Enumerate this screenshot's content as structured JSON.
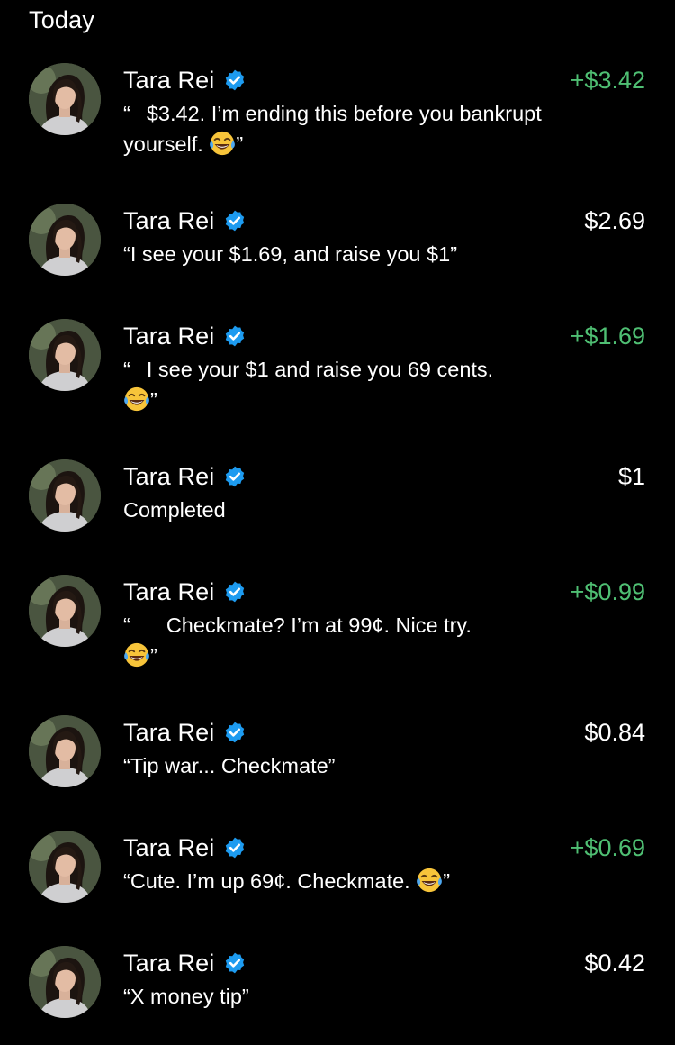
{
  "header": {
    "title": "Today"
  },
  "colors": {
    "background": "#000000",
    "text": "#ffffff",
    "incoming": "#4fbf73",
    "verified": "#1d9bf0"
  },
  "transactions": [
    {
      "name": "Tara Rei",
      "verified": true,
      "amount": "+$3.42",
      "incoming": true,
      "note_open": "“",
      "note_text": "$3.42. I’m ending this before you bankrupt yourself.",
      "note_emoji": "face-with-tears-of-joy",
      "note_close": "”",
      "note_style": "split"
    },
    {
      "name": "Tara Rei",
      "verified": true,
      "amount": "$2.69",
      "incoming": false,
      "note_open": "“",
      "note_text": "I see your $1.69, and raise you $1",
      "note_emoji": null,
      "note_close": "”",
      "note_style": "inline"
    },
    {
      "name": "Tara Rei",
      "verified": true,
      "amount": "+$1.69",
      "incoming": true,
      "note_open": "“",
      "note_text": "I see your $1 and raise you 69 cents.",
      "note_emoji": "face-with-tears-of-joy",
      "note_close": "”",
      "note_style": "split-wrap"
    },
    {
      "name": "Tara Rei",
      "verified": true,
      "amount": "$1",
      "incoming": false,
      "note_open": "",
      "note_text": "Completed",
      "note_emoji": null,
      "note_close": "",
      "note_style": "plain"
    },
    {
      "name": "Tara Rei",
      "verified": true,
      "amount": "+$0.99",
      "incoming": true,
      "note_open": "“",
      "note_text": "Checkmate? I’m at 99¢. Nice try.",
      "note_emoji": "face-with-tears-of-joy",
      "note_close": "”",
      "note_style": "split-wide"
    },
    {
      "name": "Tara Rei",
      "verified": true,
      "amount": "$0.84",
      "incoming": false,
      "note_open": "“",
      "note_text": "Tip war... Checkmate",
      "note_emoji": null,
      "note_close": "”",
      "note_style": "inline"
    },
    {
      "name": "Tara Rei",
      "verified": true,
      "amount": "+$0.69",
      "incoming": true,
      "note_open": "“",
      "note_text": "Cute. I’m up 69¢. Checkmate.",
      "note_emoji": "face-with-tears-of-joy",
      "note_close": "”",
      "note_style": "inline"
    },
    {
      "name": "Tara Rei",
      "verified": true,
      "amount": "$0.42",
      "incoming": false,
      "note_open": "“",
      "note_text": "X money tip",
      "note_emoji": null,
      "note_close": "”",
      "note_style": "inline"
    }
  ]
}
